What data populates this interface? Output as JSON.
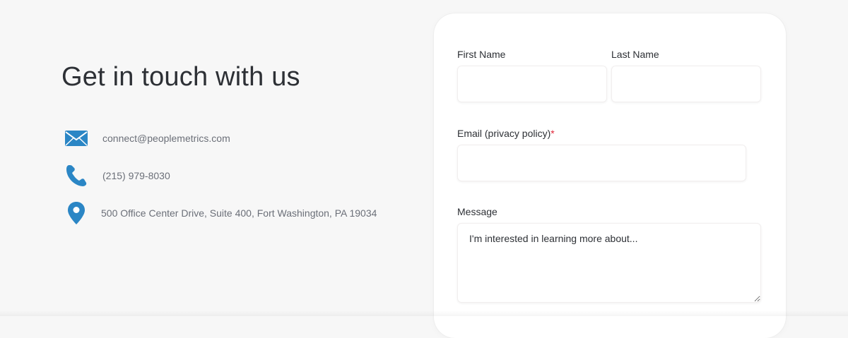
{
  "colors": {
    "background": "#f7f7f7",
    "accent_icon": "#2b86c5",
    "heading_text": "#2d3035",
    "muted_text": "#6b6f78",
    "required_marker": "#e0283a"
  },
  "contact": {
    "heading": "Get in touch with us",
    "items": [
      {
        "icon": "mail-icon",
        "text": "connect@peoplemetrics.com"
      },
      {
        "icon": "phone-icon",
        "text": "(215) 979-8030"
      },
      {
        "icon": "location-pin-icon",
        "text": "500 Office Center Drive, Suite 400, Fort Washington, PA 19034"
      }
    ]
  },
  "form": {
    "first_name": {
      "label": "First Name",
      "value": "",
      "placeholder": ""
    },
    "last_name": {
      "label": "Last Name",
      "value": "",
      "placeholder": ""
    },
    "email": {
      "label": "Email (privacy policy)",
      "required_marker": "*",
      "value": "",
      "placeholder": ""
    },
    "message": {
      "label": "Message",
      "value": "",
      "placeholder": "I'm interested in learning more about..."
    }
  }
}
